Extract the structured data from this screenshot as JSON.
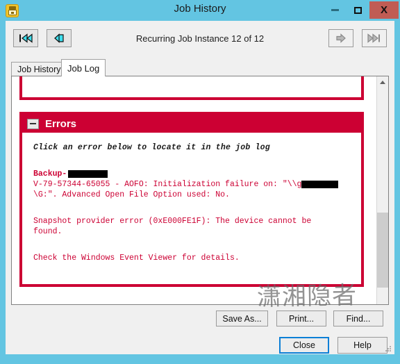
{
  "window": {
    "title": "Job History",
    "icon": "job-history-icon",
    "controls": {
      "minimize": "minimize-icon",
      "maximize": "maximize-icon",
      "close": "X"
    },
    "colors": {
      "titlebar": "#63c5e2",
      "close_button": "#c05c54",
      "error_accent": "#cc0033",
      "focus_border": "#0c7fd6"
    }
  },
  "nav": {
    "first_label": "first-instance",
    "prev_label": "previous-instance",
    "next_label": "next-instance",
    "last_label": "last-instance",
    "instance_text": "Recurring Job Instance 12 of 12"
  },
  "tabs": [
    {
      "label": "Job History",
      "active": false
    },
    {
      "label": "Job Log",
      "active": true
    }
  ],
  "errors_panel": {
    "collapse_icon": "minus-icon",
    "title": "Errors",
    "hint": "Click an error below to locate it in the job log",
    "entries": [
      {
        "name_prefix": "Backup- ",
        "name_redacted": true,
        "lines": [
          "V-79-57344-65055 - AOFO: Initialization failure on: \"\\\\g",
          "\\G:\". Advanced Open File Option used: No."
        ]
      },
      {
        "lines": [
          "Snapshot provider error (0xE000FE1F): The device cannot be",
          "found."
        ]
      },
      {
        "lines": [
          "Check the Windows Event Viewer for details."
        ]
      }
    ]
  },
  "scrollbar": {
    "up_arrow": "chevron-up-icon"
  },
  "watermark": {
    "text": "潇湘隐者"
  },
  "actions": {
    "save_as": "Save As...",
    "print": "Print...",
    "find": "Find..."
  },
  "footer": {
    "close": "Close",
    "help": "Help"
  }
}
